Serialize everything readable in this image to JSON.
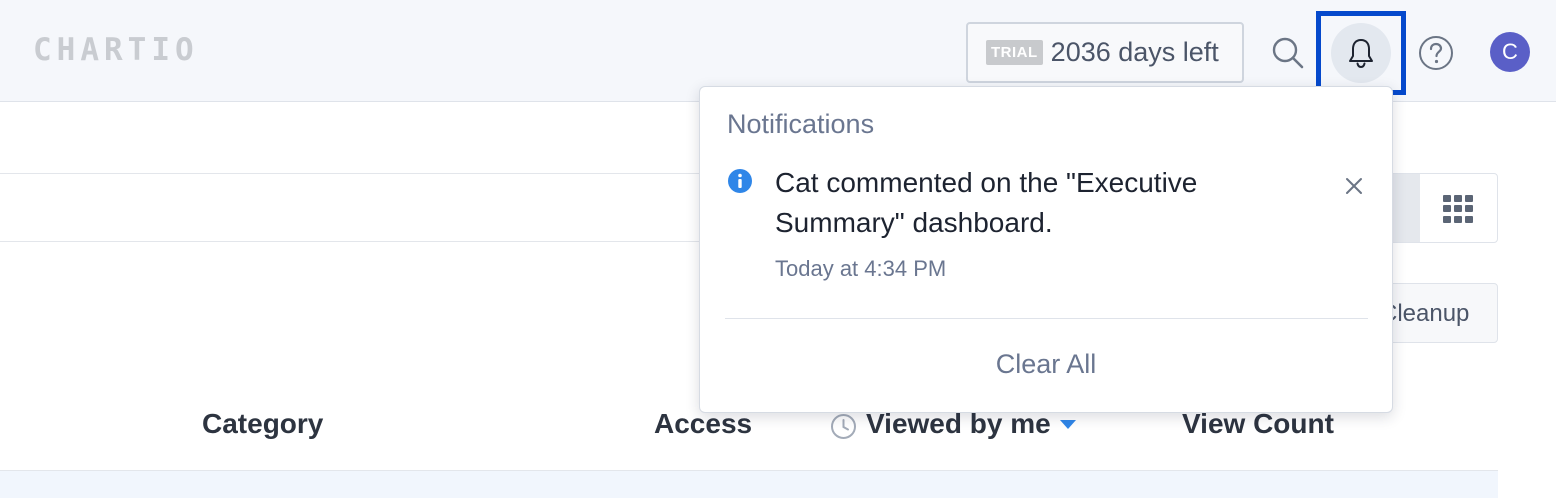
{
  "header": {
    "logo": "CHARTIO",
    "trial_badge": "TRIAL",
    "trial_text": "2036 days left",
    "avatar_initial": "C",
    "icons": [
      "search-icon",
      "bell-icon",
      "help-icon"
    ]
  },
  "page": {
    "cleanup_label": "Cleanup",
    "columns": {
      "category": "Category",
      "access": "Access",
      "viewed_by_me": "Viewed by me",
      "view_count": "View Count"
    }
  },
  "notifications": {
    "title": "Notifications",
    "items": [
      {
        "icon": "info-icon",
        "text": "Cat commented on the \"Executive Summary\" dashboard.",
        "time": "Today at 4:34 PM"
      }
    ],
    "clear_all": "Clear All"
  },
  "colors": {
    "highlight_border": "#0549cc",
    "accent_blue": "#2f86e8",
    "avatar_bg": "#5a5fc7",
    "header_bg": "#f5f7fb"
  }
}
